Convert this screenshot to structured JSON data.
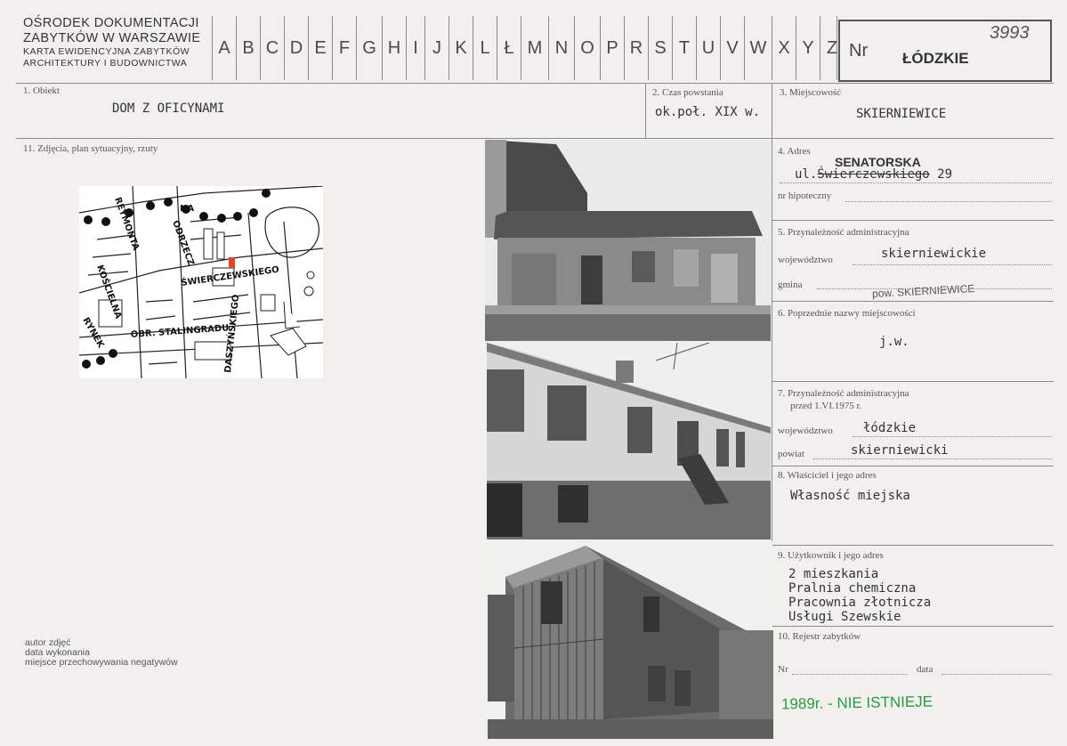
{
  "header": {
    "institution_line1": "OŚRODEK DOKUMENTACJI",
    "institution_line2": "ZABYTKÓW W WARSZAWIE",
    "card_line1": "KARTA EWIDENCYJNA ZABYTKÓW",
    "card_line2": "ARCHITEKTURY I BUDOWNICTWA",
    "letters": [
      "A",
      "B",
      "C",
      "D",
      "E",
      "F",
      "G",
      "H",
      "I",
      "J",
      "K",
      "L",
      "Ł",
      "M",
      "N",
      "O",
      "P",
      "R",
      "S",
      "T",
      "U",
      "V",
      "W",
      "X",
      "Y",
      "Z"
    ],
    "nr_label": "Nr",
    "region_stamp": "ŁÓDZKIE",
    "card_number": "3993"
  },
  "fields": {
    "obiekt_label": "1. Obiekt",
    "obiekt_value": "DOM  Z OFICYNAMI",
    "czas_label": "2. Czas powstania",
    "czas_value": "ok.poł. XIX w.",
    "miejscowosc_label": "3. Miejscowość",
    "miejscowosc_value": "SKIERNIEWICE",
    "zdjecia_label": "11. Zdjęcia, plan sytuacyjny, rzuty",
    "adres_label": "4. Adres",
    "adres_correction": "SENATORSKA",
    "adres_value_prefix": "ul.",
    "adres_struck": "Świerczewskiego",
    "adres_number": "29",
    "hipoteczny_label": "nr hipoteczny",
    "przynaleznosc_label": "5. Przynależność administracyjna",
    "wojewodztwo_label": "województwo",
    "wojewodztwo_value": "skierniewickie",
    "gmina_label": "gmina",
    "gmina_value": "pow. SKIERNIEWICE",
    "poprzednie_label": "6. Poprzednie nazwy miejscowości",
    "poprzednie_value": "j.w.",
    "przed_label_1": "7. Przynależność administracyjna",
    "przed_label_2": "przed 1.VI.1975 r.",
    "woj_przed_label": "województwo",
    "woj_przed_value": "łódzkie",
    "powiat_label": "powiat",
    "powiat_value": "skierniewicki",
    "wlasciciel_label": "8. Właściciel i jego adres",
    "wlasciciel_value": "Własność miejska",
    "uzytkownik_label": "9. Użytkownik i jego adres",
    "uzytkownik_lines": [
      "2 mieszkania",
      "Pralnia chemiczna",
      "Pracownia złotnicza",
      "Usługi Szewskie"
    ],
    "rejestr_label": "10. Rejestr zabytków",
    "nr_label": "Nr",
    "data_label": "data",
    "note": "1989r. - NIE ISTNIEJE"
  },
  "footer": {
    "autor": "autor zdjęć",
    "data_wyk": "data wykonania",
    "miejsce": "miejsce przechowywania negatywów"
  },
  "map": {
    "street1": "ŚWIERCZEWSKIEGO",
    "street2": "DASZYŃSKIEGO",
    "street3": "OBR. STALINGRADU",
    "street4": "REYMONTA",
    "street5": "RYNEK",
    "street6": "KOŚCIELNA",
    "street7": "ODRZECZ",
    "street8": "NA"
  },
  "colors": {
    "paper": "#f1f0ec",
    "rule": "#8c8c8c",
    "green_note": "#2e9a45",
    "marker": "#e0452a"
  }
}
